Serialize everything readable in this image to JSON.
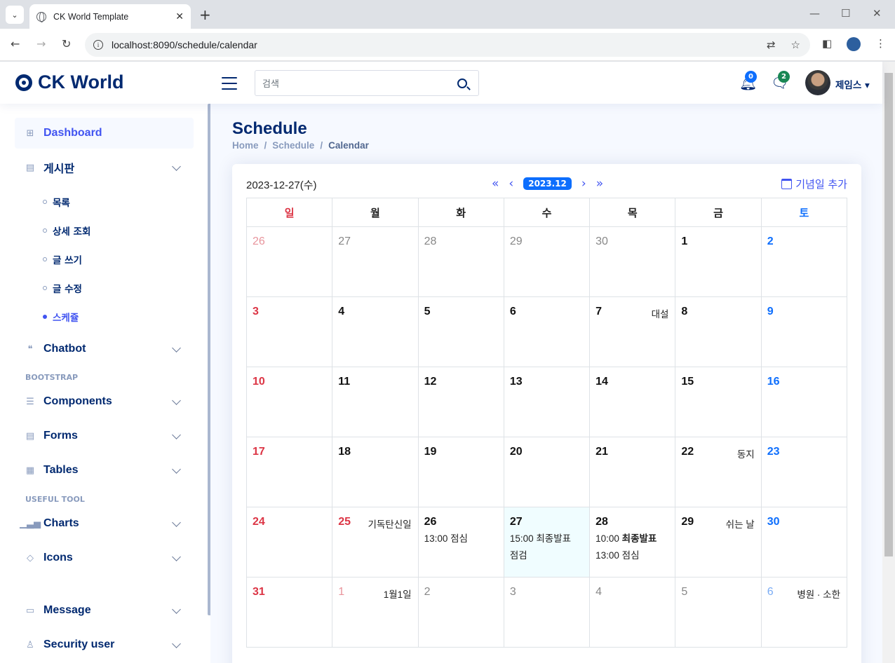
{
  "browser": {
    "tab_title": "CK World Template",
    "url": "localhost:8090/schedule/calendar",
    "tab_close": "✕",
    "new_tab": "+",
    "minimize": "—",
    "maximize": "☐",
    "close": "✕"
  },
  "header": {
    "logo_text": "CK World",
    "search_placeholder": "검색",
    "notification_count": "0",
    "message_count": "2",
    "user_name": "제임스",
    "notification_badge_color": "#0d6efd",
    "message_badge_color": "#198754"
  },
  "sidebar": {
    "items": [
      {
        "label": "Dashboard",
        "icon": "grid-icon"
      },
      {
        "label": "게시판",
        "icon": "journal-icon"
      },
      {
        "label": "Chatbot",
        "icon": "chat-quote-icon"
      },
      {
        "label": "Components",
        "icon": "menu-button-icon"
      },
      {
        "label": "Forms",
        "icon": "journal-text-icon"
      },
      {
        "label": "Tables",
        "icon": "layout-text-icon"
      },
      {
        "label": "Charts",
        "icon": "bar-chart-icon"
      },
      {
        "label": "Icons",
        "icon": "gem-icon"
      },
      {
        "label": "Message",
        "icon": "message-icon"
      },
      {
        "label": "Security user",
        "icon": "person-icon"
      }
    ],
    "board_sub": [
      "목록",
      "상세 조회",
      "글 쓰기",
      "글 수정",
      "스케쥴"
    ],
    "headings": [
      "BOOTSTRAP",
      "USEFUL TOOL"
    ]
  },
  "main": {
    "page_title": "Schedule",
    "breadcrumb": [
      "Home",
      "Schedule",
      "Calendar"
    ],
    "selected_date": "2023-12-27(수)",
    "month": "2023.12",
    "add_anniversary": "기념일 추가",
    "weekdays": [
      "일",
      "월",
      "화",
      "수",
      "목",
      "금",
      "토"
    ],
    "accent_color": "#4154f1"
  },
  "calendar": {
    "weeks": [
      [
        {
          "d": "26",
          "m": 1
        },
        {
          "d": "27",
          "m": 1
        },
        {
          "d": "28",
          "m": 1
        },
        {
          "d": "29",
          "m": 1
        },
        {
          "d": "30",
          "m": 1
        },
        {
          "d": "1"
        },
        {
          "d": "2"
        }
      ],
      [
        {
          "d": "3"
        },
        {
          "d": "4"
        },
        {
          "d": "5"
        },
        {
          "d": "6"
        },
        {
          "d": "7",
          "h": "대설"
        },
        {
          "d": "8"
        },
        {
          "d": "9"
        }
      ],
      [
        {
          "d": "10"
        },
        {
          "d": "11"
        },
        {
          "d": "12"
        },
        {
          "d": "13"
        },
        {
          "d": "14"
        },
        {
          "d": "15"
        },
        {
          "d": "16"
        }
      ],
      [
        {
          "d": "17"
        },
        {
          "d": "18"
        },
        {
          "d": "19"
        },
        {
          "d": "20"
        },
        {
          "d": "21"
        },
        {
          "d": "22",
          "h": "동지"
        },
        {
          "d": "23"
        }
      ],
      [
        {
          "d": "24"
        },
        {
          "d": "25",
          "h": "기독탄신일",
          "red": 1
        },
        {
          "d": "26",
          "e": [
            {
              "t": "13:00 점심"
            }
          ]
        },
        {
          "d": "27",
          "today": 1,
          "e": [
            {
              "t": "15:00 최종발표"
            },
            {
              "t": "점검"
            }
          ]
        },
        {
          "d": "28",
          "e": [
            {
              "t": "10:00 ",
              "b": "최종발표"
            },
            {
              "t": "13:00 점심"
            }
          ]
        },
        {
          "d": "29",
          "h": "쉬는 날"
        },
        {
          "d": "30"
        }
      ],
      [
        {
          "d": "31"
        },
        {
          "d": "1",
          "m": 1,
          "h": "1월1일",
          "red": 1
        },
        {
          "d": "2",
          "m": 1
        },
        {
          "d": "3",
          "m": 1
        },
        {
          "d": "4",
          "m": 1
        },
        {
          "d": "5",
          "m": 1
        },
        {
          "d": "6",
          "m": 1,
          "h": "병원 · 소한"
        }
      ]
    ]
  }
}
